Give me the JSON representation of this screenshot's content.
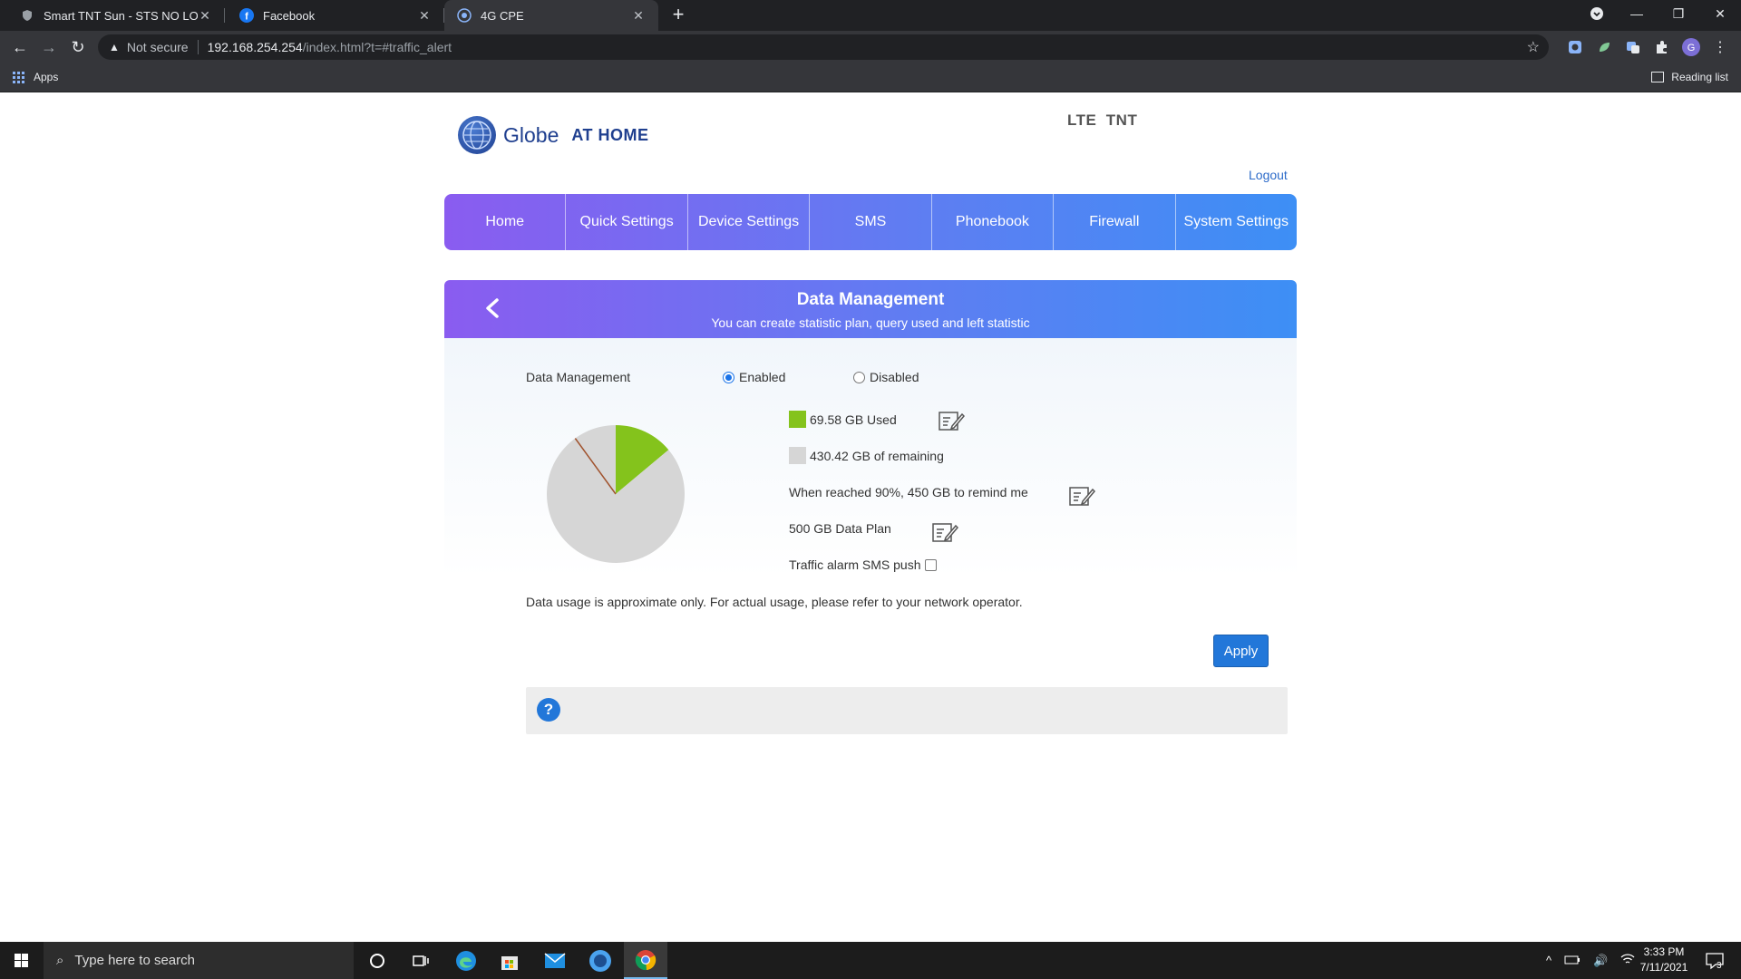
{
  "browser": {
    "tabs": [
      {
        "title": "Smart TNT Sun - STS NO LOAD -",
        "icon": "shield-icon"
      },
      {
        "title": "Facebook",
        "icon": "facebook-icon"
      },
      {
        "title": "4G CPE",
        "icon": "globe-icon"
      }
    ],
    "address": {
      "security": "Not secure",
      "host": "192.168.254.254",
      "path": "/index.html?t=#traffic_alert"
    },
    "bookmarks": {
      "apps": "Apps",
      "reading_list": "Reading list"
    }
  },
  "header": {
    "brand": "Globe",
    "brand_suffix": "AT HOME",
    "operator": "LTE  TNT",
    "logout": "Logout"
  },
  "nav": [
    "Home",
    "Quick Settings",
    "Device Settings",
    "SMS",
    "Phonebook",
    "Firewall",
    "System Settings"
  ],
  "panel": {
    "title": "Data Management",
    "subtitle": "You can create statistic plan, query used and left statistic",
    "setting_label": "Data Management",
    "options": {
      "enabled": "Enabled",
      "disabled": "Disabled"
    },
    "used": "69.58 GB Used",
    "remaining": "430.42 GB of remaining",
    "reminder": "When reached 90%, 450 GB to remind me",
    "plan": "500 GB Data Plan",
    "sms_push": "Traffic alarm SMS push",
    "note": "Data usage is approximate only. For actual usage, please refer to your network operator.",
    "apply": "Apply",
    "help": "?"
  },
  "chart_data": {
    "type": "pie",
    "slices": [
      {
        "label": "Used",
        "value": 69.58,
        "color": "#84c31c"
      },
      {
        "label": "Remaining",
        "value": 430.42,
        "color": "#d6d6d6"
      }
    ],
    "reminder_mark": {
      "label": "90% reminder",
      "value": 450
    }
  },
  "taskbar": {
    "search_placeholder": "Type here to search",
    "time": "3:33 PM",
    "date": "7/11/2021",
    "notification_count": "3"
  }
}
